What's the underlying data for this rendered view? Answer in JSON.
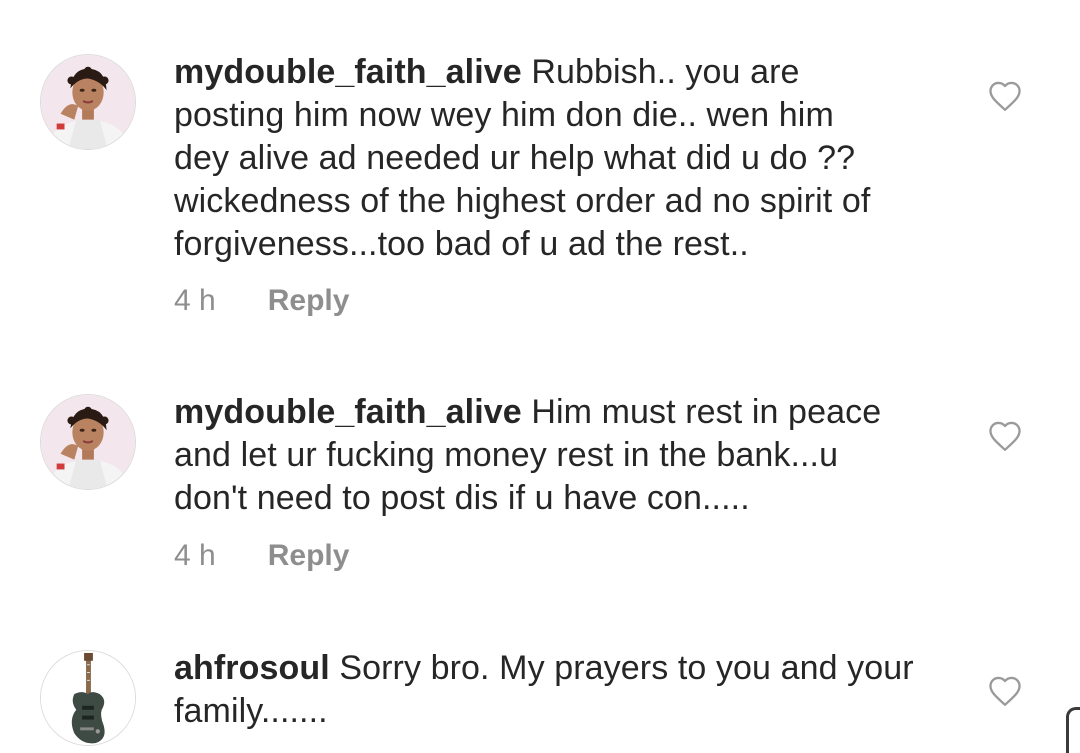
{
  "comments": [
    {
      "username": "mydouble_faith_alive",
      "lines": [
        "Rubbish.. you are",
        "posting him now wey him don die.. wen him",
        "dey alive ad needed ur help what did u do ??",
        "wickedness of the highest order ad no spirit of",
        "forgiveness...too bad of u ad the rest.."
      ],
      "time": "4 h",
      "reply_label": "Reply",
      "avatar_icon": "woman-portrait-avatar",
      "like_icon": "heart-outline-icon"
    },
    {
      "username": "mydouble_faith_alive",
      "lines": [
        "Him must rest in peace",
        "and let ur fucking money rest in the bank...u",
        "don't need to post dis if u have con....."
      ],
      "time": "4 h",
      "reply_label": "Reply",
      "avatar_icon": "woman-portrait-avatar",
      "like_icon": "heart-outline-icon"
    },
    {
      "username": "ahfrosoul",
      "lines": [
        "Sorry bro. My prayers to you and your",
        "family......."
      ],
      "avatar_icon": "guitar-avatar",
      "like_icon": "heart-outline-icon"
    }
  ]
}
